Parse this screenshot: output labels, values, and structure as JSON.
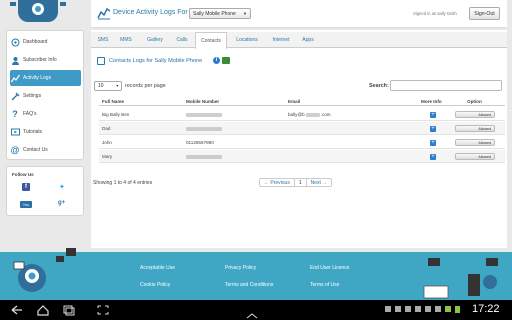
{
  "header": {
    "title": "Device Activity Logs For",
    "device_select": "Sally Mobile Phone",
    "signed_in": "Signed in as sally smith",
    "signout": "Sign-Out"
  },
  "sidebar": {
    "items": [
      {
        "label": "Dashboard",
        "icon": "dashboard-icon"
      },
      {
        "label": "Subscriber Info",
        "icon": "subscriber-icon"
      },
      {
        "label": "Activity Logs",
        "icon": "activity-icon"
      },
      {
        "label": "Settings",
        "icon": "settings-icon"
      },
      {
        "label": "FAQ's",
        "icon": "question-icon"
      },
      {
        "label": "Tutorials",
        "icon": "tutorials-icon"
      },
      {
        "label": "Contact Us",
        "icon": "at-icon"
      }
    ],
    "follow_title": "Follow Us"
  },
  "tabs": [
    "SMS",
    "MMS",
    "Gallery",
    "Calls",
    "Contacts",
    "Locations",
    "Internet",
    "Apps"
  ],
  "active_tab": "Contacts",
  "section_title": "Contacts Logs for Sally Mobile Phone",
  "records": {
    "count": "10",
    "label": "records per page"
  },
  "search_label": "Search:",
  "table": {
    "headers": [
      "Full Name",
      "Mobile Number",
      "Email",
      "More Info",
      "Option"
    ],
    "rows": [
      {
        "name": "Big Bally Ben",
        "email_suffix": ".com",
        "email_prefix": "bally@b",
        "option": "Allowed"
      },
      {
        "name": "Dad",
        "email_suffix": "",
        "email_prefix": "",
        "option": "Allowed"
      },
      {
        "name": "John",
        "mobile": "01126567890",
        "email_suffix": "",
        "email_prefix": "",
        "option": "Allowed"
      },
      {
        "name": "Mary",
        "email_suffix": "",
        "email_prefix": "",
        "option": "Allowed"
      }
    ]
  },
  "showing": "Showing 1 to 4 of 4 entries",
  "pager": {
    "prev": "← Previous",
    "page": "1",
    "next": "Next →"
  },
  "footer": {
    "links": [
      "Acceptable Use",
      "Privacy Policy",
      "End User Licence",
      "Cookie Policy",
      "Terms and Conditions",
      "Terms of Use"
    ]
  },
  "status": {
    "time": "17:22"
  },
  "colors": {
    "accent": "#3f9bc6",
    "footer": "#3fa7c4"
  }
}
